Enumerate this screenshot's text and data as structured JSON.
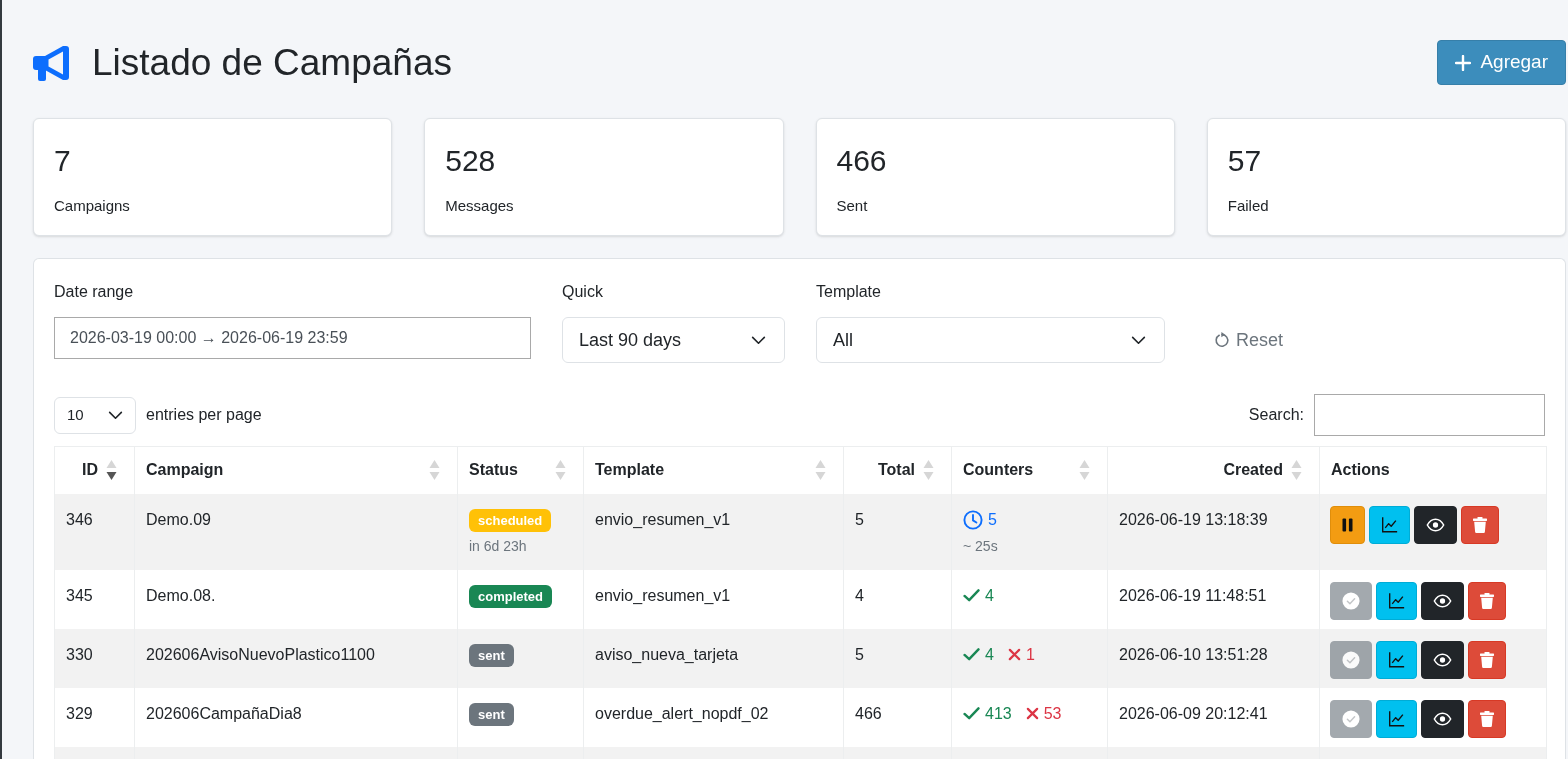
{
  "page": {
    "title": "Listado de Campañas",
    "add_button": "Agregar"
  },
  "stats": [
    {
      "value": "7",
      "label": "Campaigns"
    },
    {
      "value": "528",
      "label": "Messages"
    },
    {
      "value": "466",
      "label": "Sent"
    },
    {
      "value": "57",
      "label": "Failed"
    }
  ],
  "filters": {
    "date_range": {
      "label": "Date range",
      "value": "2026-03-19 00:00 → 2026-06-19 23:59"
    },
    "quick": {
      "label": "Quick",
      "value": "Last 90 days"
    },
    "template": {
      "label": "Template",
      "value": "All"
    },
    "reset_button": "Reset"
  },
  "table_controls": {
    "page_size": "10",
    "page_size_label": "entries per page",
    "search_label": "Search:"
  },
  "table": {
    "columns": [
      {
        "label": "ID",
        "kind": "numeric",
        "sortable": true,
        "sort_desc": true
      },
      {
        "label": "Campaign",
        "kind": "text",
        "sortable": true,
        "sort_desc": false
      },
      {
        "label": "Status",
        "kind": "text",
        "sortable": true,
        "sort_desc": false
      },
      {
        "label": "Template",
        "kind": "text",
        "sortable": true,
        "sort_desc": false
      },
      {
        "label": "Total",
        "kind": "numeric",
        "sortable": true,
        "sort_desc": false
      },
      {
        "label": "Counters",
        "kind": "text",
        "sortable": true,
        "sort_desc": false
      },
      {
        "label": "Created",
        "kind": "date",
        "sortable": true,
        "sort_desc": false
      },
      {
        "label": "Actions",
        "kind": "text",
        "sortable": false
      }
    ],
    "rows": [
      {
        "id": "346",
        "campaign": "Demo.09",
        "status": {
          "kind": "scheduled",
          "label": "scheduled",
          "note": "in 6d 23h"
        },
        "template": "envio_resumen_v1",
        "total": "5",
        "counters": [
          {
            "kind": "pending",
            "value": "5"
          }
        ],
        "counters_note": "~ 25s",
        "created": "2026-06-19 13:18:39",
        "actions": [
          {
            "kind": "pause",
            "disabled": false
          },
          {
            "kind": "chart",
            "disabled": false
          },
          {
            "kind": "view",
            "disabled": false
          },
          {
            "kind": "delete",
            "disabled": false
          }
        ]
      },
      {
        "id": "345",
        "campaign": "Demo.08.",
        "status": {
          "kind": "completed",
          "label": "completed"
        },
        "template": "envio_resumen_v1",
        "total": "4",
        "counters": [
          {
            "kind": "sent",
            "value": "4"
          }
        ],
        "created": "2026-06-19 11:48:51",
        "actions": [
          {
            "kind": "complete",
            "disabled": true
          },
          {
            "kind": "chart",
            "disabled": false
          },
          {
            "kind": "view",
            "disabled": false
          },
          {
            "kind": "delete",
            "disabled": false
          }
        ]
      },
      {
        "id": "330",
        "campaign": "202606AvisoNuevoPlastico1100",
        "status": {
          "kind": "sent",
          "label": "sent"
        },
        "template": "aviso_nueva_tarjeta",
        "total": "5",
        "counters": [
          {
            "kind": "sent",
            "value": "4"
          },
          {
            "kind": "failed",
            "value": "1"
          }
        ],
        "created": "2026-06-10 13:51:28",
        "actions": [
          {
            "kind": "complete",
            "disabled": true
          },
          {
            "kind": "chart",
            "disabled": false
          },
          {
            "kind": "view",
            "disabled": false
          },
          {
            "kind": "delete",
            "disabled": false
          }
        ]
      },
      {
        "id": "329",
        "campaign": "202606CampañaDia8",
        "status": {
          "kind": "sent",
          "label": "sent"
        },
        "template": "overdue_alert_nopdf_02",
        "total": "466",
        "counters": [
          {
            "kind": "sent",
            "value": "413"
          },
          {
            "kind": "failed",
            "value": "53"
          }
        ],
        "created": "2026-06-09 20:12:41",
        "actions": [
          {
            "kind": "complete",
            "disabled": true
          },
          {
            "kind": "chart",
            "disabled": false
          },
          {
            "kind": "view",
            "disabled": false
          },
          {
            "kind": "delete",
            "disabled": false
          }
        ]
      }
    ]
  }
}
